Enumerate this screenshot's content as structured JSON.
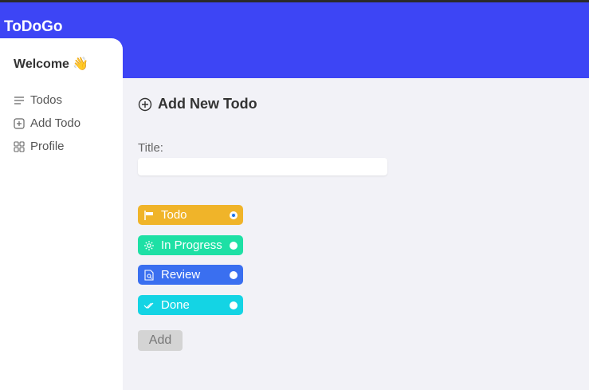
{
  "app": {
    "brand": "ToDoGo"
  },
  "colors": {
    "header": "#3d45f5",
    "todo": "#f0b429",
    "in_progress": "#1ee0a5",
    "review": "#3a6ff0",
    "done": "#14d4e4"
  },
  "sidebar": {
    "welcome": "Welcome 👋",
    "items": [
      {
        "label": "Todos",
        "icon": "list-icon"
      },
      {
        "label": "Add Todo",
        "icon": "plus-square-icon"
      },
      {
        "label": "Profile",
        "icon": "grid-icon"
      }
    ]
  },
  "main": {
    "title": "Add New Todo",
    "title_label": "Title:",
    "title_value": "",
    "statuses": [
      {
        "label": "Todo",
        "icon": "flag-icon",
        "selected": true
      },
      {
        "label": "In Progress",
        "icon": "gear-icon",
        "selected": false
      },
      {
        "label": "Review",
        "icon": "review-icon",
        "selected": false
      },
      {
        "label": "Done",
        "icon": "double-check-icon",
        "selected": false
      }
    ],
    "add_label": "Add"
  }
}
